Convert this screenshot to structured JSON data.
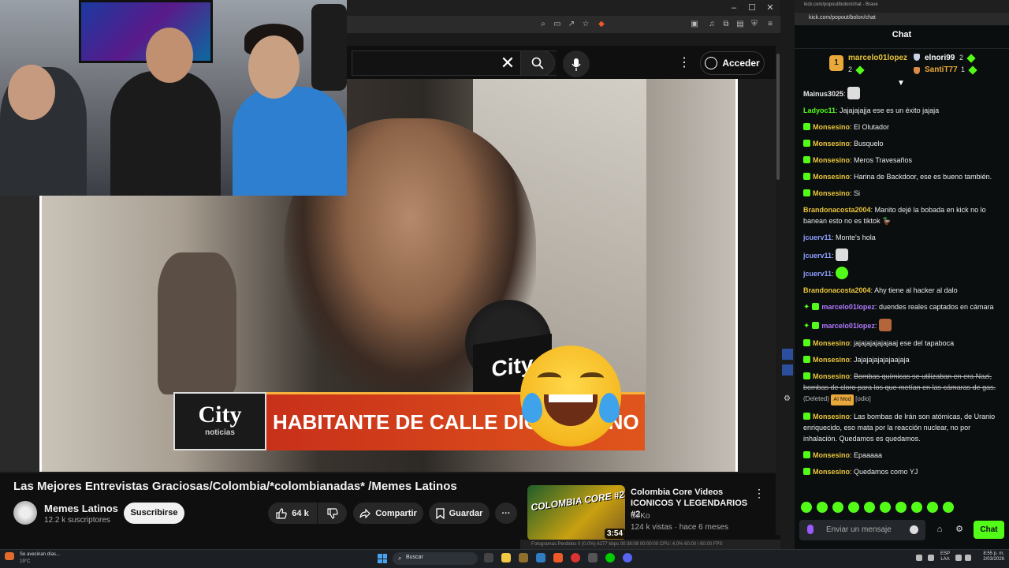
{
  "left_browser": {
    "window_controls": [
      "–",
      "☐",
      "✕"
    ],
    "signin_label": "Acceder"
  },
  "video": {
    "lower_third_text": "HABITANTE DE CALLE DICE QUE NO",
    "logo_text": "City",
    "logo_sub": "noticias",
    "mic_flag_text": "City"
  },
  "watch": {
    "title": "Las Mejores Entrevistas Graciosas/Colombia/*colombianadas* /Memes Latinos",
    "channel_name": "Memes Latinos",
    "channel_subs": "12.2 k suscriptores",
    "subscribe_label": "Suscribirse",
    "like_count": "64 k",
    "share_label": "Compartir",
    "save_label": "Guardar"
  },
  "recommendation": {
    "title": "Colombia Core Videos ICONICOS Y LEGENDARIOS #2",
    "channel": "SeKo",
    "meta": "124 k vistas · hace 6 meses",
    "duration": "3:54",
    "thumb_badge": "COLOMBIA CORE #2"
  },
  "obs_status": "Fotogramas Perdidos 0 (0.0%)   6277 kbps   00:38:08   00:00:00   CPU: 4.0%   60.00 / 60.00 FPS",
  "right_browser": {
    "window_title": "kick.com/popout/bolon/chat - Brave",
    "url": "kick.com/popout/bolon/chat",
    "chat_title": "Chat",
    "leaderboard": [
      {
        "rank": "1",
        "name": "marcelo01lopez",
        "count": "2"
      },
      {
        "name": "elnori99",
        "count": "2"
      },
      {
        "name": "SantiT77",
        "count": "1"
      }
    ],
    "messages": [
      {
        "user": "Mainus3025",
        "text": "",
        "color": "#e6e6e6",
        "badge": false,
        "emote": true
      },
      {
        "user": "Ladyoc11",
        "text": "Jajajajajja ese es un éxito jajaja",
        "color": "#53fc18",
        "badge": false
      },
      {
        "user": "Monsesino",
        "text": "El Olutador",
        "color": "#e9c53a",
        "badge": true
      },
      {
        "user": "Monsesino",
        "text": "Busquelo",
        "color": "#e9c53a",
        "badge": true
      },
      {
        "user": "Monsesino",
        "text": "Meros Travesaños",
        "color": "#e9c53a",
        "badge": true
      },
      {
        "user": "Monsesino",
        "text": "Harina de Backdoor, ese es bueno también.",
        "color": "#e9c53a",
        "badge": true
      },
      {
        "user": "Monsesino",
        "text": "Si",
        "color": "#e9c53a",
        "badge": true
      },
      {
        "user": "Brandonacosta2004",
        "text": "Manito dejé la bobada en kick no lo banean esto no es tiktok 🦆",
        "color": "#e9c53a",
        "badge": false
      },
      {
        "user": "jcuerv11",
        "text": "Monte's hola",
        "color": "#8fa0ff",
        "badge": false
      },
      {
        "user": "jcuerv11",
        "text": "",
        "color": "#8fa0ff",
        "badge": false,
        "emote": true
      },
      {
        "user": "jcuerv11",
        "text": "",
        "color": "#8fa0ff",
        "badge": false,
        "emote": true,
        "emote_green": true
      },
      {
        "user": "Brandonacosta2004",
        "text": "Ahy tiene al hacker al dalo",
        "color": "#e9c53a",
        "badge": false
      },
      {
        "user": "marcelo01lopez",
        "text": "duendes reales captados en cámara",
        "color": "#b07cff",
        "badge": true,
        "spark": true
      },
      {
        "user": "marcelo01lopez",
        "text": "",
        "color": "#b07cff",
        "badge": true,
        "spark": true,
        "emote": true,
        "emote_orange": true
      },
      {
        "user": "Monsesino",
        "text": "jajajajajajajaaj ese del tapaboca",
        "color": "#e9c53a",
        "badge": true
      },
      {
        "user": "Monsesino",
        "text": "Jajajajajajajaajaja",
        "color": "#e9c53a",
        "badge": true
      },
      {
        "user": "Monsesino",
        "text": "Bombas químicas se utilizaban en era Nazi, bombas de cloro para los que metían en las cámaras de gas.",
        "color": "#e9c53a",
        "badge": true,
        "strike": true,
        "deleted": "(Deleted)",
        "aimod": "AI Mod",
        "tag": "[odio]"
      },
      {
        "user": "Monsesino",
        "text": "Las bombas de Irán son atómicas, de Uranio enriquecido, eso mata por la reacción nuclear, no por inhalación. Quedamos es quedamos.",
        "color": "#e9c53a",
        "badge": true
      },
      {
        "user": "Monsesino",
        "text": "Epaaaaa",
        "color": "#e9c53a",
        "badge": true
      },
      {
        "user": "Monsesino",
        "text": "Quedamos como YJ",
        "color": "#e9c53a",
        "badge": true
      }
    ],
    "input_placeholder": "Enviar un mensaje",
    "send_label": "Chat"
  },
  "taskbar": {
    "weather_title": "Se avecinan días...",
    "weather_temp": "19°C",
    "search_label": "Buscar",
    "lang_top": "ESP",
    "lang_bottom": "LAA",
    "time": "8:55 p. m.",
    "date": "2/03/2026"
  },
  "colors": {
    "kick_green": "#53fc18",
    "yt_bg": "#0f0f0f",
    "lower_third": "#d9461c"
  }
}
